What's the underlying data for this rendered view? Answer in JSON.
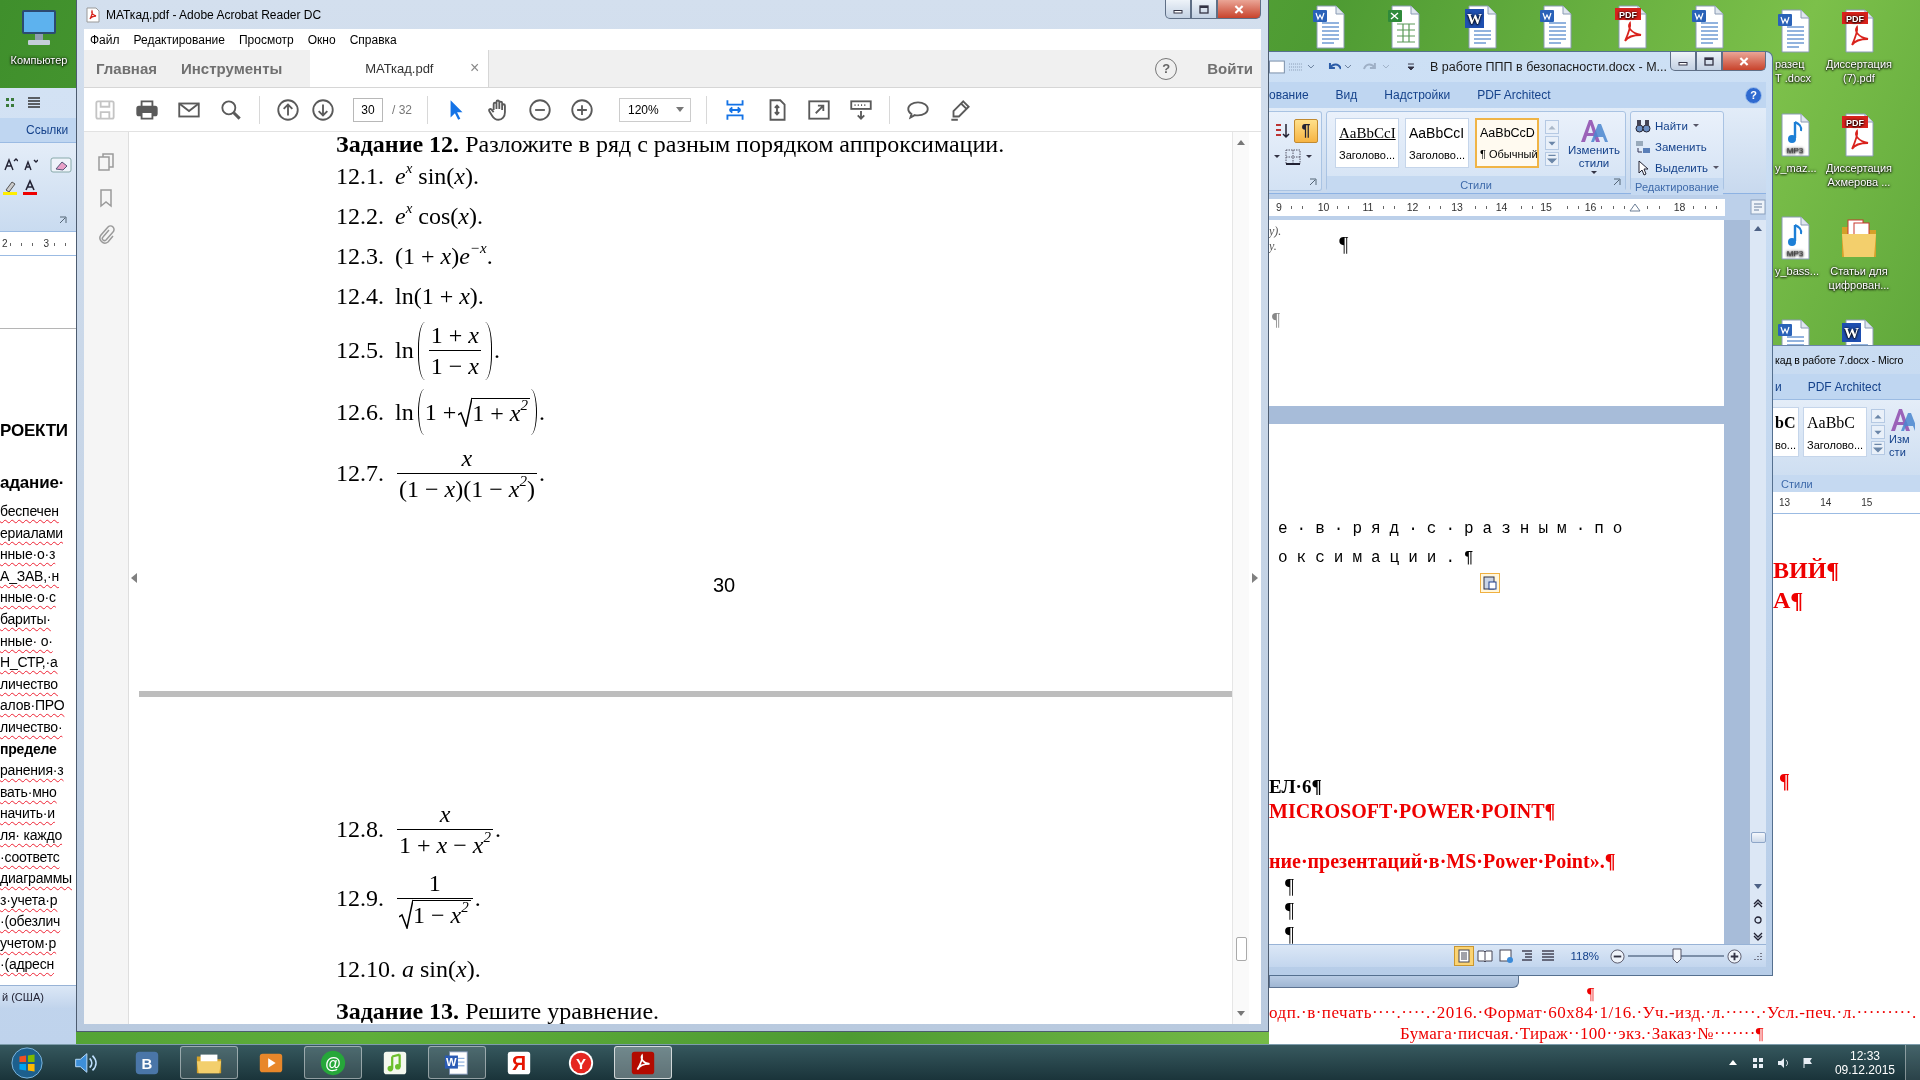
{
  "desktop": {
    "icons": [
      {
        "kind": "computer",
        "label_lines": [
          "Компьютер"
        ]
      },
      {
        "kind": "word"
      },
      {
        "kind": "excel"
      },
      {
        "kind": "word_old",
        "badge": "W"
      },
      {
        "kind": "word"
      },
      {
        "kind": "pdf",
        "badge": "PDF"
      },
      {
        "kind": "word"
      },
      {
        "kind": "word",
        "label_lines": [
          "разец",
          "Т .docx"
        ]
      },
      {
        "kind": "pdf",
        "badge": "PDF",
        "label_lines": [
          "Диссертация",
          "(7).pdf"
        ]
      },
      {
        "kind": "mp3",
        "badge": "MP3",
        "label_lines": [
          "y_maz..."
        ]
      },
      {
        "kind": "pdf",
        "badge": "PDF",
        "label_lines": [
          "Диссертация",
          "Ахмерова ..."
        ]
      },
      {
        "kind": "mp3",
        "badge": "MP3",
        "label_lines": [
          "y_bass..."
        ]
      },
      {
        "kind": "folder",
        "label_lines": [
          "Статьи для",
          "цифрован..."
        ]
      },
      {
        "kind": "word"
      },
      {
        "kind": "word_old",
        "badge": "W"
      }
    ]
  },
  "word_left": {
    "tab": "Ссылки",
    "ruler": [
      "2",
      "3"
    ],
    "lines": [
      {
        "kind": "heading",
        "text": "РОЕКТИ"
      },
      {
        "kind": "heading",
        "text": "адание·"
      },
      {
        "kind": "body",
        "text": "беспечен"
      },
      {
        "kind": "body",
        "text": "ериалами"
      },
      {
        "kind": "body",
        "text": "нные·о·з"
      },
      {
        "kind": "body",
        "text": "А_ЗАВ,·н"
      },
      {
        "kind": "body",
        "text": "нные·о·с"
      },
      {
        "kind": "body",
        "text": "бариты·"
      },
      {
        "kind": "body",
        "text": "нные· о·"
      },
      {
        "kind": "body",
        "text": "Н_СТР,·а"
      },
      {
        "kind": "body",
        "text": "личество"
      },
      {
        "kind": "body",
        "text": "алов·ПРО"
      },
      {
        "kind": "body",
        "text": "личество·"
      },
      {
        "kind": "bold",
        "text": "пределе"
      },
      {
        "kind": "body",
        "text": "ранения·з"
      },
      {
        "kind": "body",
        "text": "вать·мно"
      },
      {
        "kind": "body",
        "text": "начить·и"
      },
      {
        "kind": "body",
        "text": "ля· каждо"
      },
      {
        "kind": "body",
        "text": "·соответс"
      },
      {
        "kind": "body",
        "text": "диаграммы"
      },
      {
        "kind": "body",
        "text": "з·учета·р"
      },
      {
        "kind": "body",
        "text": "·(обезлич"
      },
      {
        "kind": "body",
        "text": "учетом·р"
      },
      {
        "kind": "body",
        "text": "·(адресн"
      }
    ],
    "status": "й (США)"
  },
  "acrobat": {
    "title": "МАТкад.pdf - Adobe Acrobat Reader DC",
    "menu": [
      "Файл",
      "Редактирование",
      "Просмотр",
      "Окно",
      "Справка"
    ],
    "tabs": [
      {
        "kind": "nav",
        "label": "Главная",
        "selected": false
      },
      {
        "kind": "nav",
        "label": "Инструменты",
        "selected": false
      },
      {
        "kind": "document",
        "label": "МАТкад.pdf",
        "close": "×",
        "selected": true
      }
    ],
    "help": "?",
    "sign_in": "Войти",
    "toolbar": [
      [
        {
          "kind": "save",
          "selected": false,
          "disabled": true
        },
        {
          "kind": "print",
          "selected": false,
          "disabled": false
        },
        {
          "kind": "email",
          "selected": false,
          "disabled": false
        },
        {
          "kind": "search",
          "selected": false,
          "disabled": false
        }
      ],
      [
        {
          "kind": "prev_page",
          "selected": false,
          "disabled": false
        },
        {
          "kind": "next_page",
          "selected": false,
          "disabled": false
        },
        {
          "kind": "page_field",
          "value": "30",
          "total": "/ 32"
        }
      ],
      [
        {
          "kind": "select",
          "selected": true,
          "disabled": false
        },
        {
          "kind": "hand",
          "selected": false,
          "disabled": false
        },
        {
          "kind": "zoom_out",
          "selected": false,
          "disabled": false
        },
        {
          "kind": "zoom_in",
          "selected": false,
          "disabled": false
        },
        {
          "kind": "zoom_field",
          "value": "120%"
        }
      ],
      [
        {
          "kind": "fit_page",
          "selected": true,
          "disabled": false
        },
        {
          "kind": "fit_width",
          "selected": false,
          "disabled": false
        },
        {
          "kind": "full_screen",
          "selected": false,
          "disabled": false
        },
        {
          "kind": "read_mode",
          "selected": false,
          "disabled": false
        }
      ],
      [
        {
          "kind": "comment",
          "selected": false,
          "disabled": false
        },
        {
          "kind": "highlight",
          "selected": false,
          "disabled": false
        }
      ]
    ],
    "pages": [
      {
        "lines": [
          {
            "kind": "task",
            "text": "**Задание 12.** Разложите в ряд с разным порядком аппроксимации."
          },
          {
            "kind": "formula",
            "number": "12.1.",
            "expr": "*e*$^{x}$ sin(*x*)."
          },
          {
            "kind": "formula",
            "number": "12.2.",
            "expr": "*e*$^{x}$ cos(*x*)."
          },
          {
            "kind": "formula",
            "number": "12.3.",
            "expr": "(1 + *x*)*e*$^{−x}$."
          },
          {
            "kind": "formula",
            "number": "12.4.",
            "expr": "ln(1 + *x*)."
          },
          {
            "kind": "fraction",
            "number": "12.5.",
            "prefix": "ln",
            "parens": true,
            "numerator": "1 + *x*",
            "denominator": "1 − *x*",
            "root": false,
            "suffix": "."
          },
          {
            "kind": "radical",
            "number": "12.6.",
            "prefix": "ln",
            "parens": true,
            "lead": "1 +",
            "radicand": "1 + *x*$^{2}$",
            "suffix": "."
          },
          {
            "kind": "fraction",
            "number": "12.7.",
            "parens": false,
            "numerator": "*x*",
            "denominator": "(1 − *x*)(1 − *x*$^{2}$)",
            "root": false,
            "suffix": "."
          }
        ],
        "page_number": "30"
      },
      {
        "lines": [
          {
            "kind": "fraction",
            "number": "12.8.",
            "parens": false,
            "numerator": "*x*",
            "denominator": "1 + *x* − *x*$^{2}$",
            "root": false,
            "suffix": "."
          },
          {
            "kind": "fraction",
            "number": "12.9.",
            "parens": false,
            "numerator": "1",
            "denominator": "1 − *x*$^{2}$",
            "root": true,
            "suffix": "."
          },
          {
            "kind": "formula",
            "number": "12.10.",
            "expr": "*a* sin(*x*)."
          },
          {
            "kind": "task",
            "text": "**Задание 13.** Решите уравнение."
          }
        ]
      }
    ]
  },
  "word_main": {
    "title": "В работе ППП в безопасности.docx - M...",
    "tabs": [
      {
        "label": "ование",
        "selected": false
      },
      {
        "label": "Вид",
        "selected": false
      },
      {
        "label": "Надстройки",
        "selected": false
      },
      {
        "label": "PDF Architect",
        "selected": false
      }
    ],
    "help": "?",
    "show_marks": {
      "label": "¶",
      "on": true
    },
    "styles": [
      {
        "kind": "underlined",
        "sample": "AaBbCcI",
        "name": "Заголово...",
        "selected": false
      },
      {
        "kind": "sans",
        "sample": "AaBbCcI",
        "name": "Заголово...",
        "selected": false
      },
      {
        "kind": "normal",
        "sample": "AaBbCcD",
        "name": "¶ Обычный",
        "selected": true
      }
    ],
    "change_styles": "Изменить стили",
    "styles_group": "Стили",
    "editing": [
      {
        "kind": "find",
        "label": "Найти",
        "dropdown": true
      },
      {
        "kind": "replace",
        "label": "Заменить",
        "dropdown": false
      },
      {
        "kind": "select",
        "label": "Выделить",
        "dropdown": true
      }
    ],
    "editing_group": "Редактирование",
    "ruler": [
      "9",
      "10",
      "11",
      "12",
      "13",
      "14",
      "15",
      "16",
      "18"
    ],
    "page_1": {
      "fragments": [
        "y).",
        "y."
      ],
      "marks": [
        "¶",
        "¶"
      ]
    },
    "page_2": [
      {
        "kind": "spaced",
        "text": "е·в·ряд·с·разным·по"
      },
      {
        "kind": "spaced",
        "text": "оксимации.¶"
      },
      {
        "kind": "heading",
        "text": "ЕЛ·6¶"
      },
      {
        "kind": "red_heading",
        "text": "MICROSOFT·POWER·POINT¶"
      },
      {
        "kind": "red_heading",
        "text": "ние·презентаций·в·MS·Power·Point».¶"
      },
      {
        "kind": "mark",
        "text": "¶"
      },
      {
        "kind": "mark",
        "text": "¶"
      },
      {
        "kind": "mark",
        "text": "¶"
      }
    ],
    "views": [
      {
        "kind": "print_layout",
        "selected": true
      },
      {
        "kind": "reading",
        "selected": false
      },
      {
        "kind": "web",
        "selected": false
      },
      {
        "kind": "outline",
        "selected": false
      },
      {
        "kind": "draft",
        "selected": false
      }
    ],
    "zoom": "118%",
    "zoom_slider": {
      "level": 0.51
    }
  },
  "word_back": {
    "title": "кад в работе 7.docx - Micro",
    "tabs": [
      {
        "label": "и",
        "selected": false
      },
      {
        "label": "PDF Architect",
        "selected": false
      }
    ],
    "styles": [
      {
        "kind": "bold",
        "sample": "bC",
        "name": "во...",
        "selected": false
      },
      {
        "kind": "serif",
        "sample": "AaBbC",
        "name": "Заголово...",
        "selected": false
      }
    ],
    "change_styles": "Изм сти",
    "styles_group": "Стили",
    "ruler": [
      "13",
      "14",
      "15"
    ],
    "lines": [
      {
        "kind": "red_heading",
        "text": "ВИЙ¶"
      },
      {
        "kind": "red_heading",
        "text": "А¶"
      },
      {
        "kind": "red_mark",
        "text": "¶"
      }
    ],
    "bottom": {
      "mark": "¶",
      "lines": [
        "одп.·в·печать····.····.·2016.·Формат·60x84·1/16.·Уч.-изд.·л.·····.·Усл.-печ.·л.·········.",
        "Бумага·писчая.·Тираж··100··экз.·Заказ·№·······¶"
      ]
    }
  },
  "taskbar": {
    "apps": [
      {
        "kind": "speaker",
        "running": false,
        "selected": false
      },
      {
        "kind": "letter_tile",
        "glyph": "B",
        "running": false,
        "selected": false
      },
      {
        "kind": "explorer",
        "running": true,
        "selected": false
      },
      {
        "kind": "media",
        "running": false,
        "selected": false
      },
      {
        "kind": "mail",
        "glyph": "@",
        "running": true,
        "selected": false
      },
      {
        "kind": "music",
        "running": false,
        "selected": false
      },
      {
        "kind": "word",
        "glyph": "W",
        "running": true,
        "selected": false
      },
      {
        "kind": "letter",
        "glyph": "Я",
        "running": false,
        "selected": false
      },
      {
        "kind": "letter_circle",
        "glyph": "Y",
        "running": false,
        "selected": false
      },
      {
        "kind": "acrobat",
        "running": true,
        "selected": true
      }
    ],
    "time": "12:33",
    "date": "09.12.2015"
  }
}
